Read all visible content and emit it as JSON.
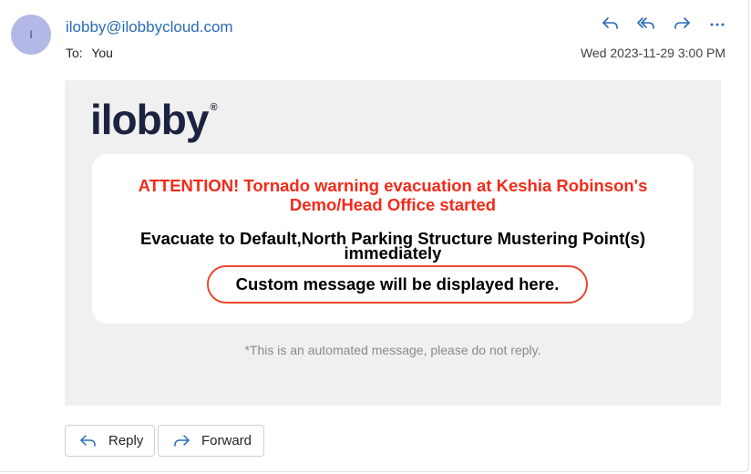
{
  "header": {
    "avatar_initial": "I",
    "sender": "ilobby@ilobbycloud.com",
    "to_label": "To:",
    "to_value": "You",
    "timestamp": "Wed 2023-11-29 3:00 PM",
    "actions": [
      {
        "name": "reply",
        "icon": "reply-icon"
      },
      {
        "name": "reply-all",
        "icon": "reply-all-icon"
      },
      {
        "name": "forward",
        "icon": "forward-icon"
      },
      {
        "name": "more",
        "icon": "more-icon"
      }
    ]
  },
  "body": {
    "logo_text": "ilobby",
    "logo_mark": "®",
    "alert_title": "ATTENTION! Tornado warning evacuation at Keshia Robinson's Demo/Head Office started",
    "evacuate_text": "Evacuate to Default,North Parking Structure Mustering Point(s) immediately",
    "custom_message": "Custom message will be displayed here.",
    "automated_note": "*This is an automated message, please do not reply.",
    "colors": {
      "alert": "#f22b1a",
      "highlight_border": "#e8492c",
      "logo": "#1c2340",
      "sender_link": "#2a6bb5"
    }
  },
  "footer": {
    "reply_label": "Reply",
    "forward_label": "Forward"
  }
}
